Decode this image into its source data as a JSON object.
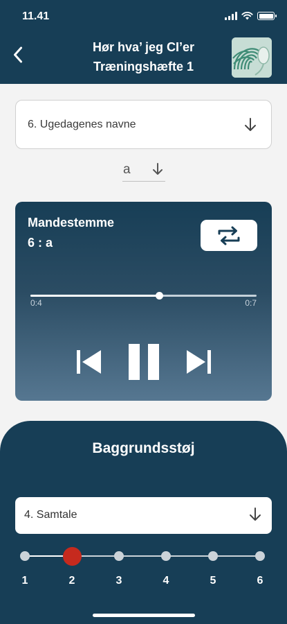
{
  "status_bar": {
    "time": "11.41"
  },
  "header": {
    "title_line1": "Hør hva’ jeg CI’er",
    "title_line2": "Træningshæfte 1",
    "back_icon": "chevron-left-icon",
    "logo": "app-logo"
  },
  "exercise": {
    "selected": "6. Ugedagenes navne",
    "voice_option": "a"
  },
  "player": {
    "track_name": "Mandestemme",
    "track_sub": "6 : a",
    "time_current": "0:4",
    "time_total": "0:7",
    "progress_fraction": 0.57,
    "state": "playing",
    "icons": [
      "repeat-icon",
      "skip-previous-icon",
      "pause-icon",
      "skip-next-icon"
    ]
  },
  "background_noise": {
    "title": "Baggrundsstøj",
    "selected": "4. Samtale",
    "levels": [
      "1",
      "2",
      "3",
      "4",
      "5",
      "6"
    ],
    "selected_level": 2
  },
  "colors": {
    "primary": "#173e56",
    "player_gradient_end": "#567791",
    "accent_red": "#c62a1e",
    "page_bg": "#f3f3f3"
  }
}
